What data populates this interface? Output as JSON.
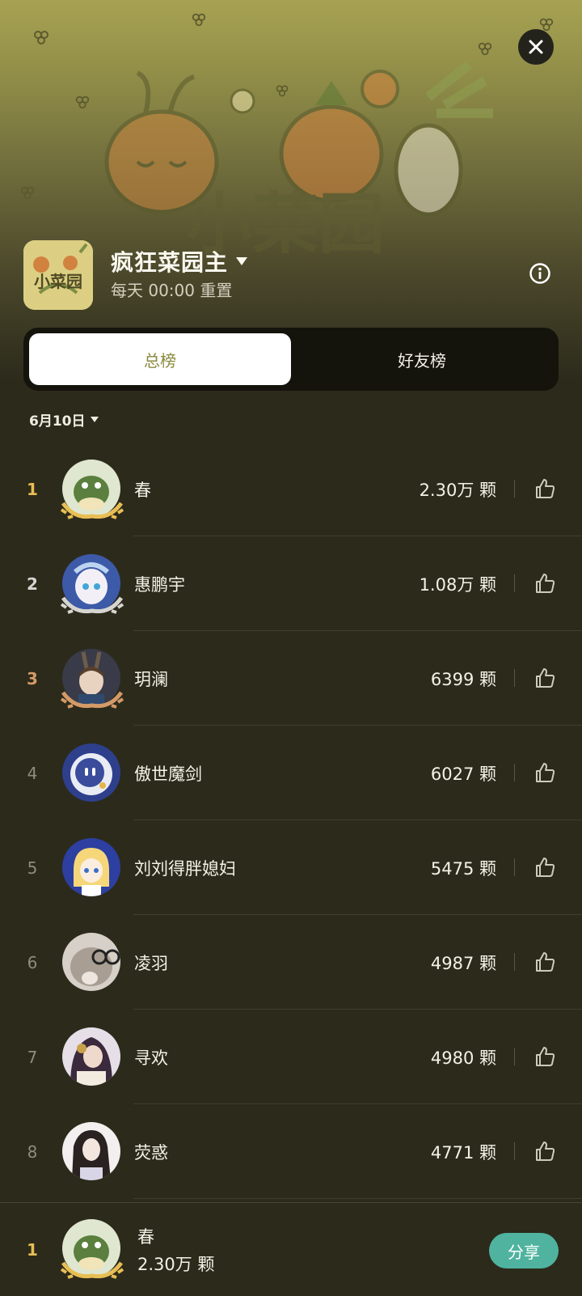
{
  "header": {
    "title": "疯狂菜园主",
    "reset_text": "每天 00:00 重置",
    "icon_logo_text": "小菜园"
  },
  "tabs": [
    {
      "label": "总榜",
      "active": true
    },
    {
      "label": "好友榜",
      "active": false
    }
  ],
  "date_selector": {
    "label": "6月10日"
  },
  "leaderboard": [
    {
      "rank": "1",
      "name": "春",
      "score": "2.30万 颗",
      "avatar_color": "#5a7f3e"
    },
    {
      "rank": "2",
      "name": "惠鹏宇",
      "score": "1.08万 颗",
      "avatar_color": "#3d5aa8"
    },
    {
      "rank": "3",
      "name": "玥澜",
      "score": "6399 颗",
      "avatar_color": "#3a3b48"
    },
    {
      "rank": "4",
      "name": "傲世魔剑",
      "score": "6027 颗",
      "avatar_color": "#2e3f8c"
    },
    {
      "rank": "5",
      "name": "刘刘得胖媳妇",
      "score": "5475 颗",
      "avatar_color": "#2d3fa0"
    },
    {
      "rank": "6",
      "name": "凌羽",
      "score": "4987 颗",
      "avatar_color": "#b9b3ad"
    },
    {
      "rank": "7",
      "name": "寻欢",
      "score": "4980 颗",
      "avatar_color": "#5a3a4a"
    },
    {
      "rank": "8",
      "name": "荧惑",
      "score": "4771 颗",
      "avatar_color": "#dad3cf"
    }
  ],
  "my_rank": {
    "rank": "1",
    "name": "春",
    "score": "2.30万 颗"
  },
  "share_button": {
    "label": "分享"
  },
  "colors": {
    "accent_olive": "#8a8a3e",
    "share_teal": "#4fb39f",
    "gold": "#e7be54",
    "silver": "#d7d5d0",
    "bronze": "#d49a67"
  }
}
